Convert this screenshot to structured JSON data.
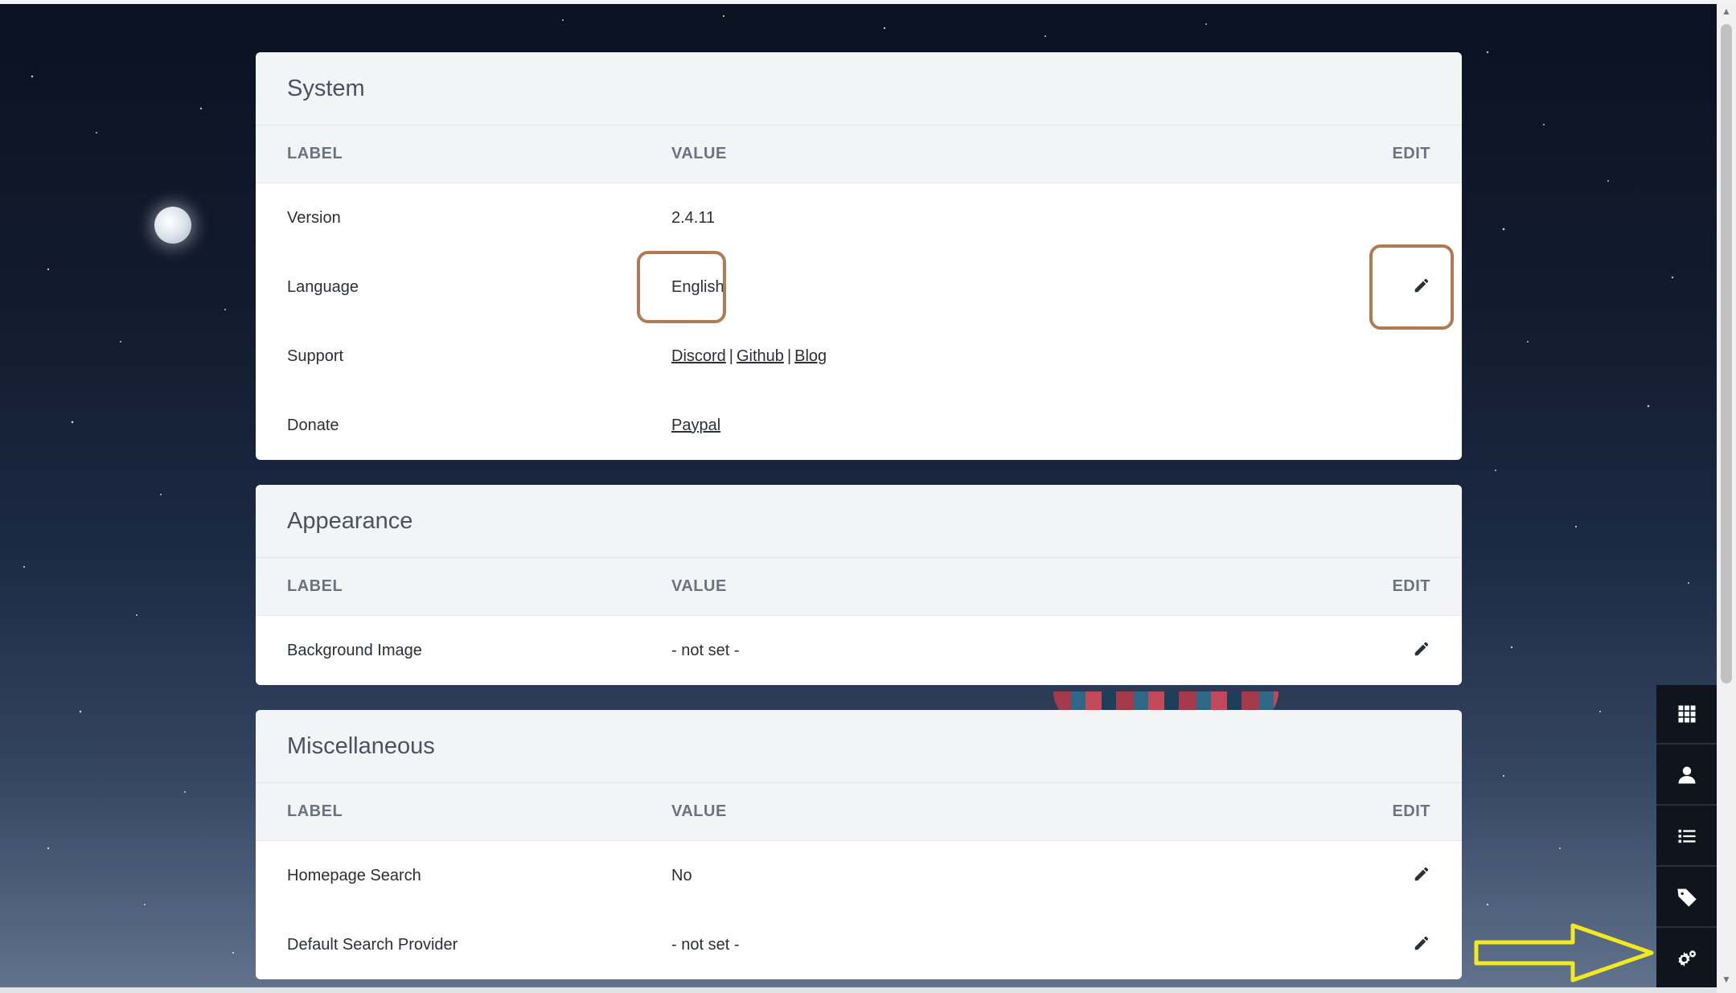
{
  "system": {
    "title": "System",
    "headers": {
      "label": "LABEL",
      "value": "VALUE",
      "edit": "EDIT"
    },
    "rows": [
      {
        "label": "Version",
        "value": "2.4.11"
      },
      {
        "label": "Language",
        "value": "English"
      },
      {
        "label": "Support",
        "links": [
          "Discord",
          "Github",
          "Blog"
        ],
        "separator": "|"
      },
      {
        "label": "Donate",
        "link": "Paypal"
      }
    ]
  },
  "appearance": {
    "title": "Appearance",
    "headers": {
      "label": "LABEL",
      "value": "VALUE",
      "edit": "EDIT"
    },
    "rows": [
      {
        "label": "Background Image",
        "value": "- not set -"
      }
    ]
  },
  "misc": {
    "title": "Miscellaneous",
    "headers": {
      "label": "LABEL",
      "value": "VALUE",
      "edit": "EDIT"
    },
    "rows": [
      {
        "label": "Homepage Search",
        "value": "No"
      },
      {
        "label": "Default Search Provider",
        "value": "- not set -"
      }
    ]
  },
  "sidebar": {
    "icons": [
      "grid-icon",
      "user-icon",
      "list-icon",
      "tag-icon",
      "settings-icon"
    ]
  },
  "colors": {
    "highlight_box": "#b07a54",
    "annotation_arrow": "#f2ea1e",
    "sidebar_bg": "#0f141d"
  }
}
